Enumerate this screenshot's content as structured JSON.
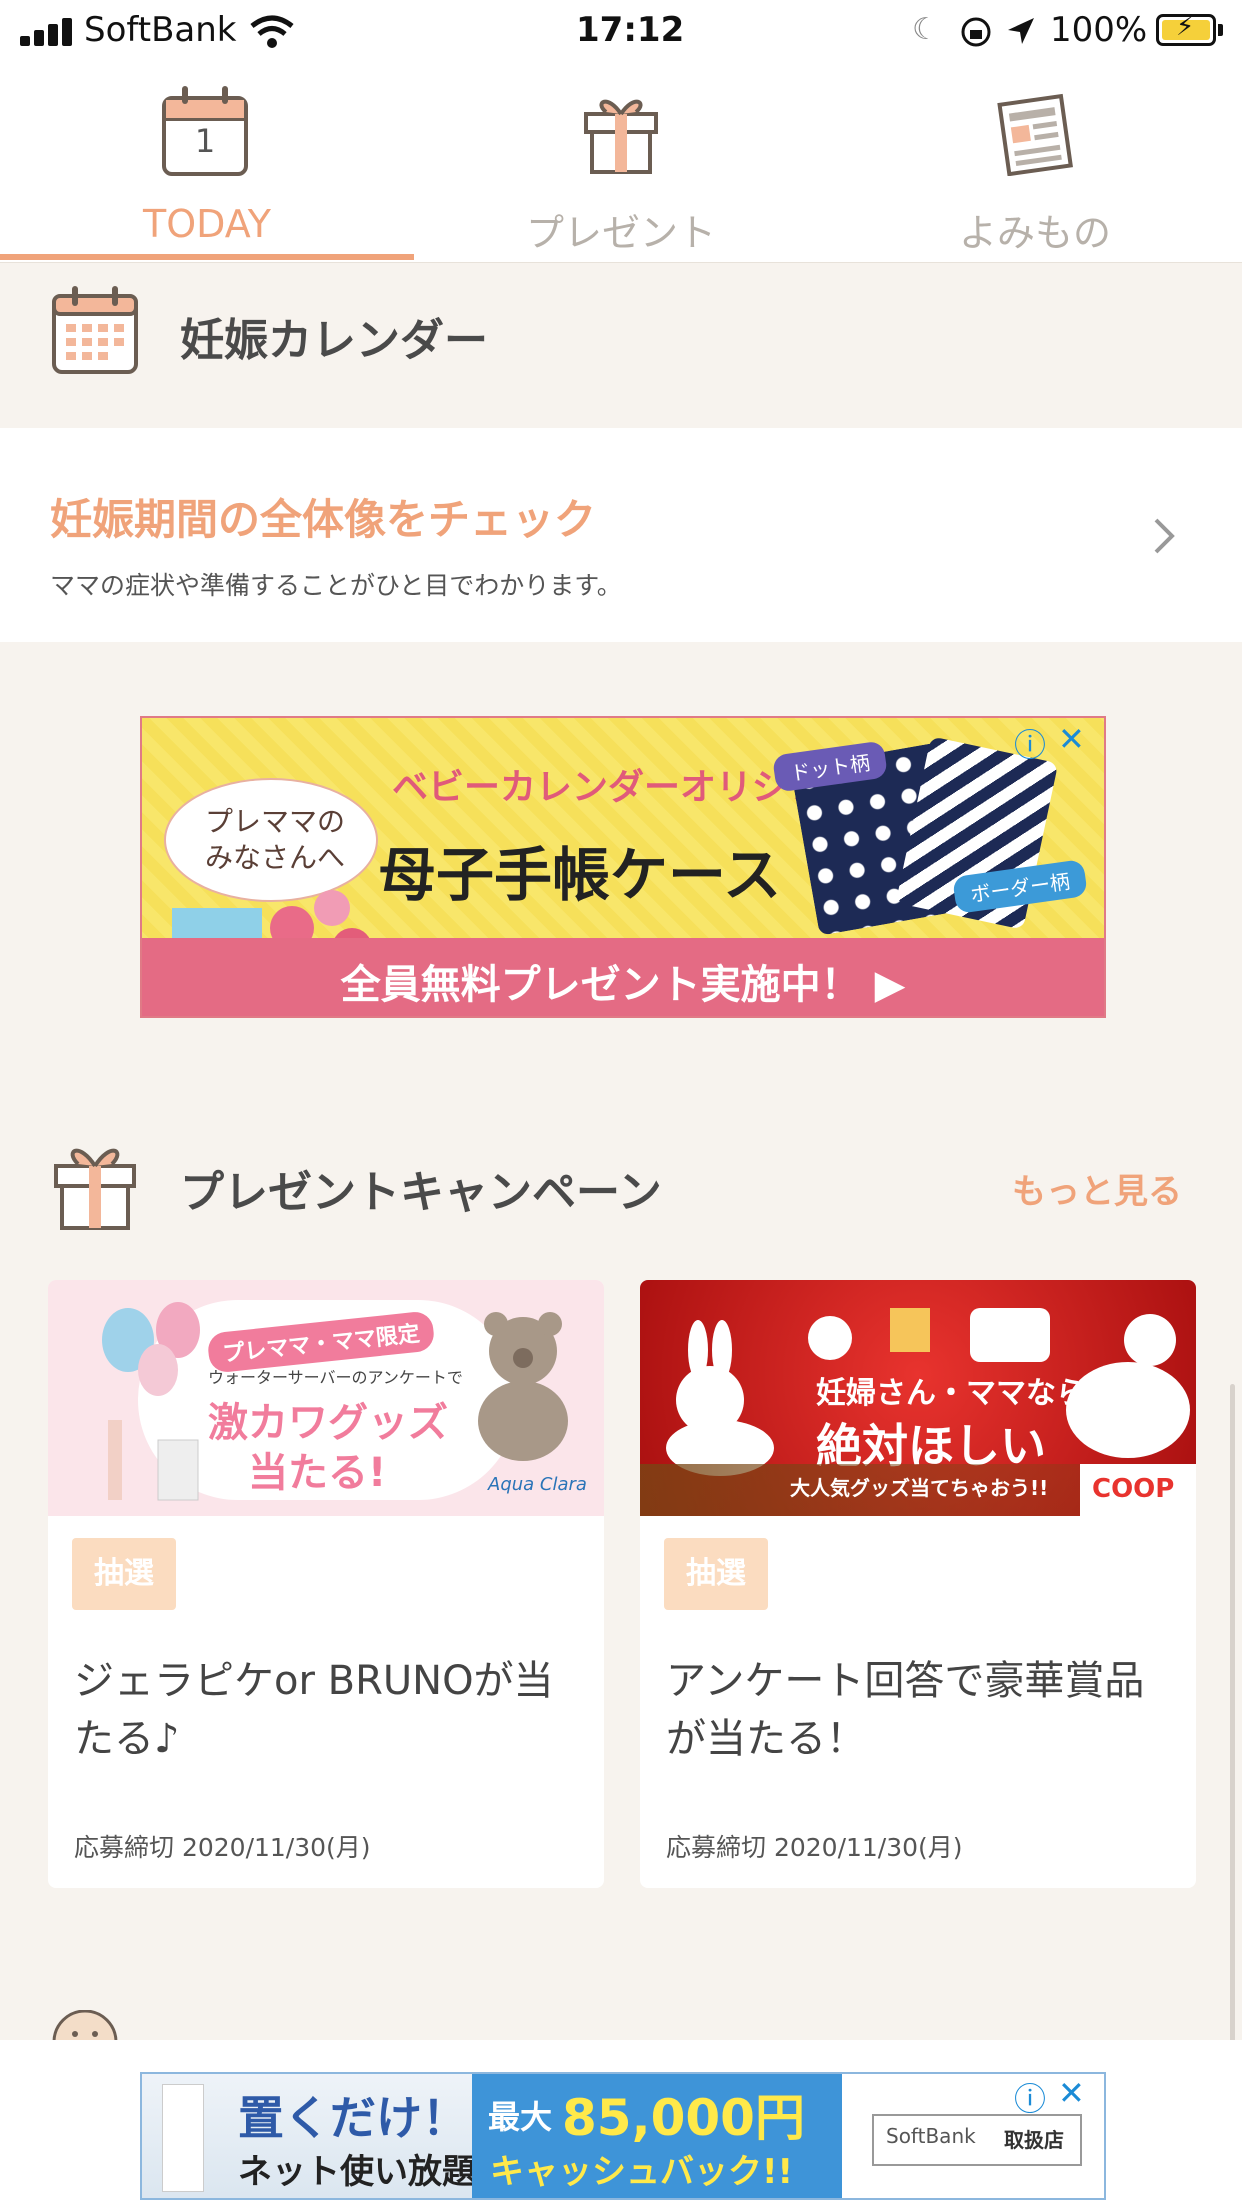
{
  "status_bar": {
    "carrier": "SoftBank",
    "time": "17:12",
    "battery": "100%"
  },
  "tabs": [
    {
      "label": "TODAY",
      "calendar_day": "1",
      "active": true
    },
    {
      "label": "プレゼント",
      "active": false
    },
    {
      "label": "よみもの",
      "active": false
    }
  ],
  "pregnancy_calendar": {
    "title": "妊娠カレンダー",
    "link_title": "妊娠期間の全体像をチェック",
    "link_subtitle": "ママの症状や準備することがひと目でわかります。"
  },
  "ad_banner": {
    "tag": "プレママの\nみなさんへ",
    "headline": "ベビーカレンダーオリジナル",
    "product": "母子手帳ケース",
    "label_dot": "ドット柄",
    "label_border": "ボーダー柄",
    "cta": "全員無料プレゼント実施中！ ▶"
  },
  "present_campaign": {
    "title": "プレゼントキャンペーン",
    "more": "もっと見る",
    "cards": [
      {
        "img_tag": "プレママ・ママ限定",
        "img_line": "ウォーターサーバーのアンケートで",
        "img_main1": "激カワグッズ",
        "img_main2": "当たる!",
        "img_brand": "Aqua Clara",
        "badge": "抽選",
        "title": "ジェラピケor BRUNOが当たる♪",
        "deadline": "応募締切 2020/11/30(月)"
      },
      {
        "img_line1": "妊婦さん・ママなら",
        "img_main": "絶対ほしい",
        "img_sub": "大人気グッズ当てちゃおう!!",
        "img_brand": "COOP",
        "badge": "抽選",
        "title": "アンケート回答で豪華賞品が当たる！",
        "deadline": "応募締切 2020/11/30(月)"
      }
    ]
  },
  "bottom_ad": {
    "line1": "置くだけ！",
    "line2": "ネット使い放題",
    "amount_prefix": "最大",
    "amount": "85,000円",
    "amount_sub": "キャッシュバック!!",
    "brand": "SoftBank",
    "store": "取扱店"
  },
  "colors": {
    "accent": "#f0a37a",
    "badge": "#fbdcc0",
    "background": "#f7f3ee"
  }
}
